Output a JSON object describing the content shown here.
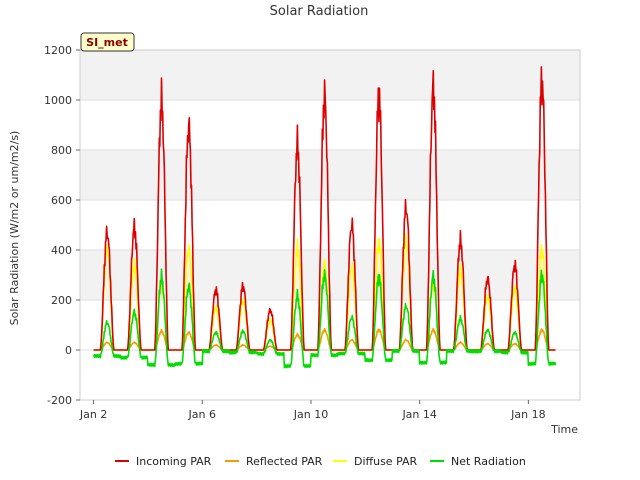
{
  "chart_data": {
    "type": "line",
    "title": "Solar Radiation",
    "xlabel": "Time",
    "ylabel": "Solar Radiation (W/m2 or um/m2/s)",
    "station_tag": "SI_met",
    "xlim": [
      1.5,
      19.9
    ],
    "ylim": [
      -200,
      1200
    ],
    "yticks": [
      -200,
      0,
      200,
      400,
      600,
      800,
      1000,
      1200
    ],
    "xticks": [
      {
        "day": 2,
        "label": "Jan 2"
      },
      {
        "day": 6,
        "label": "Jan 6"
      },
      {
        "day": 10,
        "label": "Jan 10"
      },
      {
        "day": 14,
        "label": "Jan 14"
      },
      {
        "day": 18,
        "label": "Jan 18"
      }
    ],
    "shaded_bands": [
      [
        200,
        400
      ],
      [
        600,
        800
      ],
      [
        1000,
        1200
      ]
    ],
    "colors": {
      "incoming": "#dd0000",
      "reflected": "#ff9900",
      "diffuse": "#ffff00",
      "net": "#00dd00",
      "band": "#f2f2f2",
      "grid": "#dddddd",
      "tag_bg": "#ffffcc"
    },
    "series": [
      {
        "key": "incoming",
        "name": "Incoming PAR"
      },
      {
        "key": "reflected",
        "name": "Reflected PAR"
      },
      {
        "key": "diffuse",
        "name": "Diffuse PAR"
      },
      {
        "key": "net",
        "name": "Net Radiation"
      }
    ],
    "days": [
      {
        "noon": 2.5,
        "incoming": 470,
        "reflected": 30,
        "diffuse": 400,
        "net": 110,
        "night": -25
      },
      {
        "noon": 3.5,
        "incoming": 490,
        "reflected": 30,
        "diffuse": 340,
        "net": 150,
        "night": -30
      },
      {
        "noon": 4.5,
        "incoming": 995,
        "reflected": 75,
        "diffuse": 260,
        "net": 290,
        "night": -60
      },
      {
        "noon": 5.5,
        "incoming": 895,
        "reflected": 70,
        "diffuse": 405,
        "net": 255,
        "night": -55
      },
      {
        "noon": 6.5,
        "incoming": 240,
        "reflected": 20,
        "diffuse": 170,
        "net": 70,
        "night": -5
      },
      {
        "noon": 7.5,
        "incoming": 255,
        "reflected": 20,
        "diffuse": 195,
        "net": 75,
        "night": -10
      },
      {
        "noon": 8.5,
        "incoming": 160,
        "reflected": 15,
        "diffuse": 120,
        "net": 40,
        "night": -15
      },
      {
        "noon": 9.5,
        "incoming": 820,
        "reflected": 60,
        "diffuse": 405,
        "net": 215,
        "night": -65
      },
      {
        "noon": 10.5,
        "incoming": 1015,
        "reflected": 80,
        "diffuse": 340,
        "net": 300,
        "night": -20
      },
      {
        "noon": 11.5,
        "incoming": 500,
        "reflected": 40,
        "diffuse": 330,
        "net": 130,
        "night": -15
      },
      {
        "noon": 12.5,
        "incoming": 1015,
        "reflected": 80,
        "diffuse": 430,
        "net": 290,
        "night": -40
      },
      {
        "noon": 13.5,
        "incoming": 570,
        "reflected": 40,
        "diffuse": 440,
        "net": 175,
        "night": -5
      },
      {
        "noon": 14.5,
        "incoming": 1050,
        "reflected": 80,
        "diffuse": 260,
        "net": 295,
        "night": -50
      },
      {
        "noon": 15.5,
        "incoming": 435,
        "reflected": 30,
        "diffuse": 315,
        "net": 125,
        "night": -5
      },
      {
        "noon": 16.5,
        "incoming": 285,
        "reflected": 25,
        "diffuse": 215,
        "net": 80,
        "night": -5
      },
      {
        "noon": 17.5,
        "incoming": 340,
        "reflected": 25,
        "diffuse": 245,
        "net": 70,
        "night": -10
      },
      {
        "noon": 18.5,
        "incoming": 1075,
        "reflected": 80,
        "diffuse": 400,
        "net": 300,
        "night": -55
      }
    ]
  }
}
